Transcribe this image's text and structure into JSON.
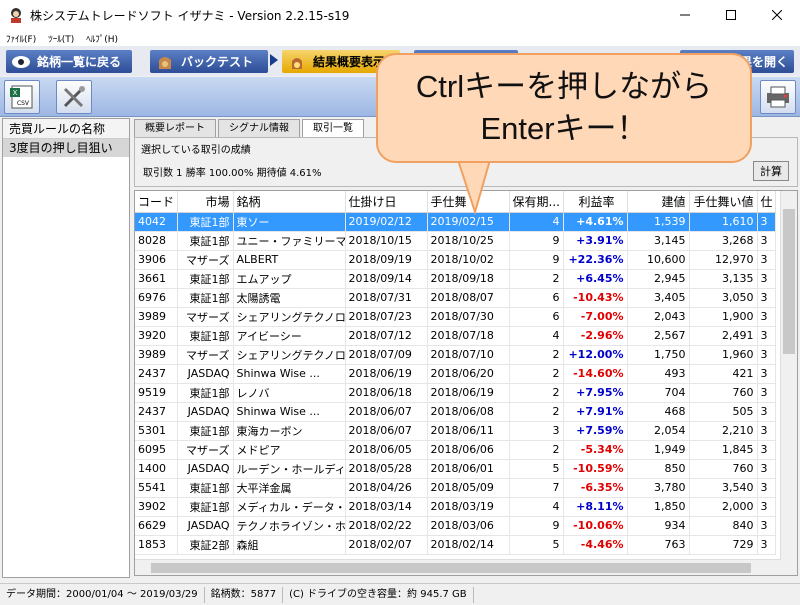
{
  "window": {
    "title": "株システムトレードソフト イザナミ - Version 2.2.15-s19"
  },
  "menu": {
    "items": [
      "ﾌｧｲﾙ(F)",
      "ﾂｰﾙ(T)",
      "ﾍﾙﾌﾟ(H)"
    ]
  },
  "nav": {
    "back_label": "銘柄一覧に戻る",
    "backtest_label": "バックテスト",
    "summary_label": "結果概要表示",
    "open_label": "果を開く"
  },
  "left_panel": {
    "header": "売買ルールの名称",
    "rule": "3度目の押し目狙い"
  },
  "tabs": [
    "概要レポート",
    "シグナル情報",
    "取引一覧"
  ],
  "group": {
    "title": "選択している取引の成績",
    "summary": "取引数 1  勝率 100.00%  期待値 4.61%",
    "calc_button": "計算"
  },
  "table": {
    "headers": [
      "コード",
      "市場",
      "銘柄",
      "仕掛け日",
      "手仕舞",
      "保有期...",
      "利益率",
      "建値",
      "手仕舞い値",
      "仕"
    ],
    "rows": [
      [
        "4042",
        "東証1部",
        "東ソー",
        "2019/02/12",
        "2019/02/15",
        "4",
        "+4.61%",
        "1,539",
        "1,610",
        "3"
      ],
      [
        "8028",
        "東証1部",
        "ユニー・ファミリーマ...",
        "2018/10/15",
        "2018/10/25",
        "9",
        "+3.91%",
        "3,145",
        "3,268",
        "3"
      ],
      [
        "3906",
        "マザーズ",
        "ALBERT",
        "2018/09/19",
        "2018/10/02",
        "9",
        "+22.36%",
        "10,600",
        "12,970",
        "3"
      ],
      [
        "3661",
        "東証1部",
        "エムアップ",
        "2018/09/14",
        "2018/09/18",
        "2",
        "+6.45%",
        "2,945",
        "3,135",
        "3"
      ],
      [
        "6976",
        "東証1部",
        "太陽誘電",
        "2018/07/31",
        "2018/08/07",
        "6",
        "-10.43%",
        "3,405",
        "3,050",
        "3"
      ],
      [
        "3989",
        "マザーズ",
        "シェアリングテクノロ...",
        "2018/07/23",
        "2018/07/30",
        "6",
        "-7.00%",
        "2,043",
        "1,900",
        "3"
      ],
      [
        "3920",
        "東証1部",
        "アイビーシー",
        "2018/07/12",
        "2018/07/18",
        "4",
        "-2.96%",
        "2,567",
        "2,491",
        "3"
      ],
      [
        "3989",
        "マザーズ",
        "シェアリングテクノロ...",
        "2018/07/09",
        "2018/07/10",
        "2",
        "+12.00%",
        "1,750",
        "1,960",
        "3"
      ],
      [
        "2437",
        "JASDAQ",
        "Shinwa Wise ...",
        "2018/06/19",
        "2018/06/20",
        "2",
        "-14.60%",
        "493",
        "421",
        "3"
      ],
      [
        "9519",
        "東証1部",
        "レノバ",
        "2018/06/18",
        "2018/06/19",
        "2",
        "+7.95%",
        "704",
        "760",
        "3"
      ],
      [
        "2437",
        "JASDAQ",
        "Shinwa Wise ...",
        "2018/06/07",
        "2018/06/08",
        "2",
        "+7.91%",
        "468",
        "505",
        "3"
      ],
      [
        "5301",
        "東証1部",
        "東海カーボン",
        "2018/06/07",
        "2018/06/11",
        "3",
        "+7.59%",
        "2,054",
        "2,210",
        "3"
      ],
      [
        "6095",
        "マザーズ",
        "メドピア",
        "2018/06/05",
        "2018/06/06",
        "2",
        "-5.34%",
        "1,949",
        "1,845",
        "3"
      ],
      [
        "1400",
        "JASDAQ",
        "ルーデン・ホールディ...",
        "2018/05/28",
        "2018/06/01",
        "5",
        "-10.59%",
        "850",
        "760",
        "3"
      ],
      [
        "5541",
        "東証1部",
        "大平洋金属",
        "2018/04/26",
        "2018/05/09",
        "7",
        "-6.35%",
        "3,780",
        "3,540",
        "3"
      ],
      [
        "3902",
        "東証1部",
        "メディカル・データ・ビ...",
        "2018/03/14",
        "2018/03/19",
        "4",
        "+8.11%",
        "1,850",
        "2,000",
        "3"
      ],
      [
        "6629",
        "JASDAQ",
        "テクノホライゾン・ホ...",
        "2018/02/22",
        "2018/03/06",
        "9",
        "-10.06%",
        "934",
        "840",
        "3"
      ],
      [
        "1853",
        "東証2部",
        "森組",
        "2018/02/07",
        "2018/02/14",
        "5",
        "-4.46%",
        "763",
        "729",
        "3"
      ]
    ]
  },
  "status": {
    "period": "データ期間：2000/01/04 〜 2019/03/29",
    "count": "銘柄数：5877",
    "disk": "(C) ドライブの空き容量：約 945.7 GB"
  },
  "callout": {
    "line1": "Ctrlキーを押しながら",
    "line2": "Enterキー！"
  },
  "colors": {
    "selected_row": "#3399ff",
    "positive": "#0000cc",
    "negative": "#e00000",
    "callout_fill": "#ffd8b8"
  }
}
